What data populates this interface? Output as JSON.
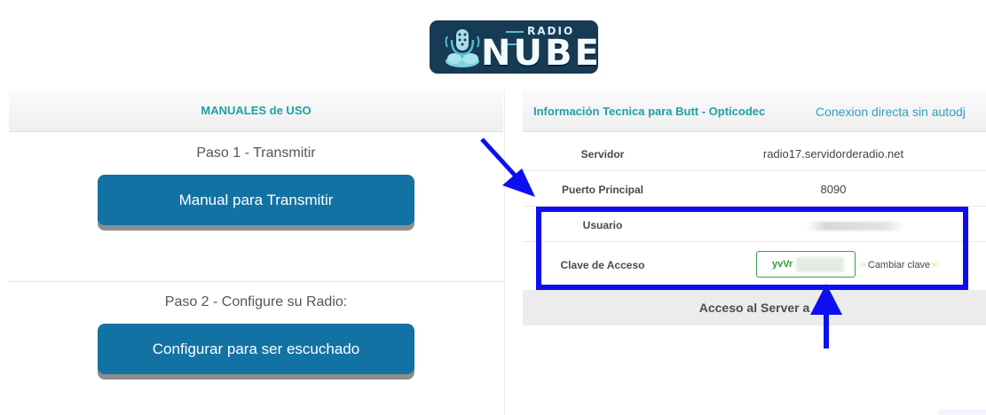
{
  "logo": {
    "top_text": "RADIO",
    "main_text": "NUBE"
  },
  "left_panel": {
    "header": "MANUALES de USO",
    "step1": {
      "label": "Paso 1 - Transmitir",
      "button": "Manual para Transmitir"
    },
    "step2": {
      "label": "Paso 2 - Configure su Radio:",
      "button": "Configurar para ser escuchado"
    }
  },
  "right_panel": {
    "title": "Información Tecnica para Butt - Opticodec",
    "tab": "Conexion directa sin autodj",
    "rows": [
      {
        "label": "Servidor",
        "value": "radio17.servidorderadio.net"
      },
      {
        "label": "Puerto Principal",
        "value": "8090"
      },
      {
        "label": "Usuario",
        "value": ""
      },
      {
        "label": "Clave de Acceso",
        "value": "yvVr"
      }
    ],
    "change_password": "Cambiar clave",
    "access_bar": "Acceso al Server a"
  },
  "icons": {
    "hand_left": "pointing-hand-icon",
    "hand_right": "pointing-hand-icon"
  },
  "colors": {
    "accent_teal": "#1ea0a5",
    "button_blue": "#1272a3",
    "annotation_blue": "#0d0ff0",
    "password_green": "#39a04a"
  }
}
